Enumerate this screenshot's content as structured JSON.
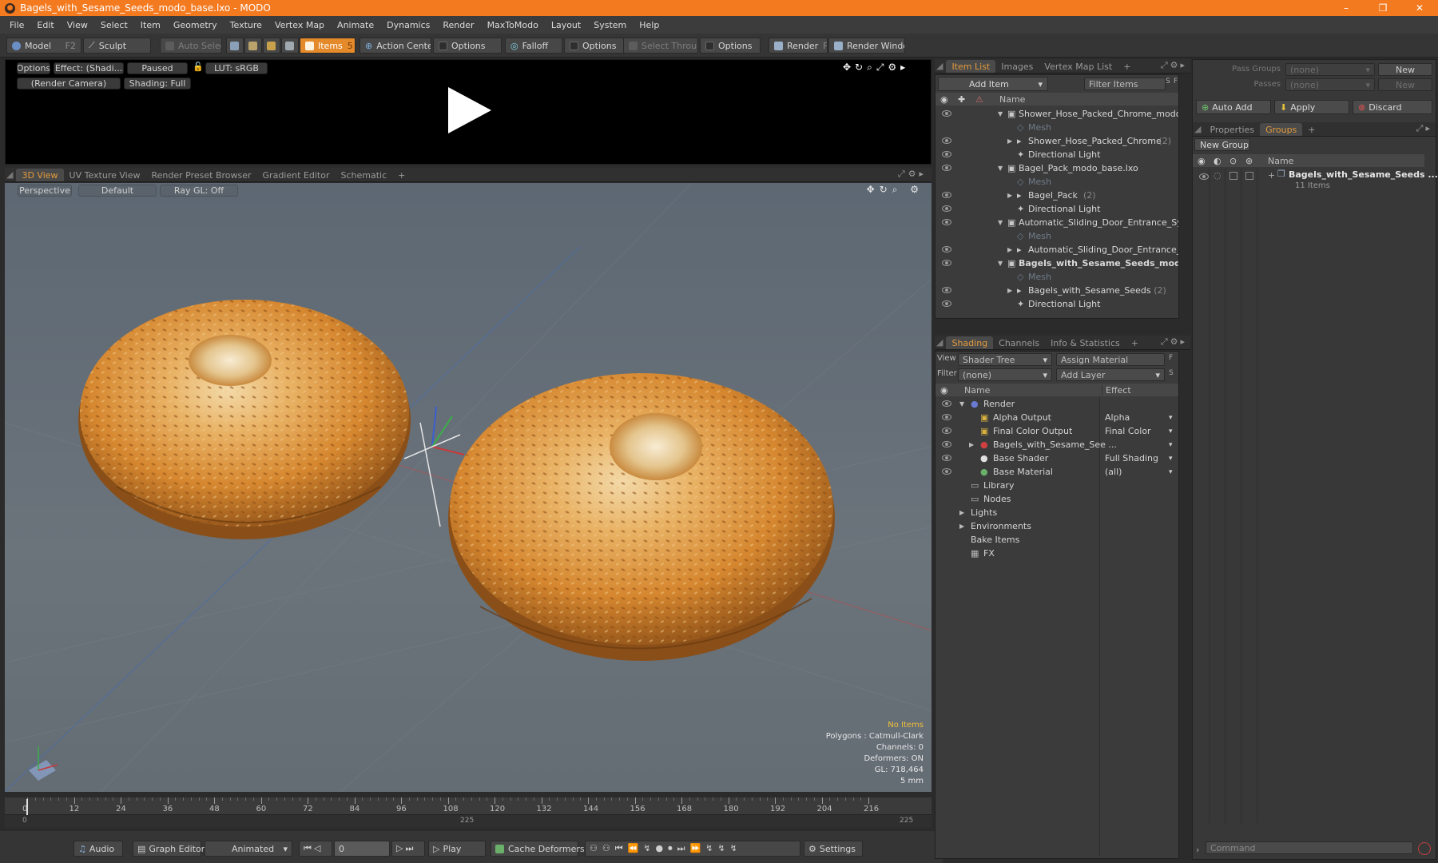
{
  "window": {
    "title": "Bagels_with_Sesame_Seeds_modo_base.lxo - MODO",
    "minimize": "–",
    "maximize": "❐",
    "close": "✕"
  },
  "menu": [
    "File",
    "Edit",
    "View",
    "Select",
    "Item",
    "Geometry",
    "Texture",
    "Vertex Map",
    "Animate",
    "Dynamics",
    "Render",
    "MaxToModo",
    "Layout",
    "System",
    "Help"
  ],
  "toolbar": {
    "model": "Model",
    "model_key": "F2",
    "sculpt": "Sculpt",
    "auto_select": "Auto Select",
    "items": "Items",
    "items_key": "5",
    "action_center": "Action Center",
    "options1": "Options",
    "falloff": "Falloff",
    "options2": "Options",
    "select_through": "Select Through",
    "options3": "Options",
    "render": "Render",
    "render_key": "F9",
    "render_window": "Render Window"
  },
  "preview": {
    "options": "Options",
    "effect": "Effect: (Shadi...",
    "paused": "Paused",
    "lut": "LUT: sRGB",
    "camera": "(Render Camera)",
    "shading": "Shading: Full"
  },
  "viewtabs": [
    "3D View",
    "UV Texture View",
    "Render Preset Browser",
    "Gradient Editor",
    "Schematic",
    "+"
  ],
  "viewport": {
    "perspective": "Perspective",
    "default": "Default",
    "raygl": "Ray GL: Off",
    "info": {
      "no_items": "No Items",
      "polygons": "Polygons : Catmull-Clark",
      "channels": "Channels: 0",
      "deformers": "Deformers: ON",
      "gl": "GL: 718,464",
      "scale": "5 mm"
    }
  },
  "timeline": {
    "ticks": [
      "0",
      "12",
      "24",
      "36",
      "48",
      "60",
      "72",
      "84",
      "96",
      "108",
      "120",
      "132",
      "144",
      "156",
      "168",
      "180",
      "192",
      "204",
      "216"
    ],
    "start": "0",
    "mid": "225",
    "end": "225"
  },
  "bottombar": {
    "audio": "Audio",
    "graph_editor": "Graph Editor",
    "animated": "Animated",
    "frame": "0",
    "play": "Play",
    "cache_deformers": "Cache Deformers",
    "settings": "Settings"
  },
  "itemlist": {
    "tabs": [
      "Item List",
      "Images",
      "Vertex Map List",
      "+"
    ],
    "add_item": "Add Item",
    "filter_items": "Filter Items",
    "s": "S",
    "f": "F",
    "name_col": "Name",
    "rows": [
      {
        "label": "Shower_Hose_Packed_Chrome_modo_b...",
        "indent": 0,
        "arrow": "▼",
        "bold": false,
        "dim": false,
        "count": ""
      },
      {
        "label": "Mesh",
        "indent": 1,
        "arrow": "",
        "bold": false,
        "dim": true,
        "count": ""
      },
      {
        "label": "Shower_Hose_Packed_Chrome",
        "indent": 1,
        "arrow": "▶",
        "bold": false,
        "dim": false,
        "count": "(2)"
      },
      {
        "label": "Directional Light",
        "indent": 1,
        "arrow": "",
        "bold": false,
        "dim": false,
        "count": ""
      },
      {
        "label": "Bagel_Pack_modo_base.lxo",
        "indent": 0,
        "arrow": "▼",
        "bold": false,
        "dim": false,
        "count": ""
      },
      {
        "label": "Mesh",
        "indent": 1,
        "arrow": "",
        "bold": false,
        "dim": true,
        "count": ""
      },
      {
        "label": "Bagel_Pack",
        "indent": 1,
        "arrow": "▶",
        "bold": false,
        "dim": false,
        "count": "(2)"
      },
      {
        "label": "Directional Light",
        "indent": 1,
        "arrow": "",
        "bold": false,
        "dim": false,
        "count": ""
      },
      {
        "label": "Automatic_Sliding_Door_Entrance_Syste...",
        "indent": 0,
        "arrow": "▼",
        "bold": false,
        "dim": false,
        "count": ""
      },
      {
        "label": "Mesh",
        "indent": 1,
        "arrow": "",
        "bold": false,
        "dim": true,
        "count": ""
      },
      {
        "label": "Automatic_Sliding_Door_Entrance_Sy...",
        "indent": 1,
        "arrow": "▶",
        "bold": false,
        "dim": false,
        "count": ""
      },
      {
        "label": "Bagels_with_Sesame_Seeds_mod...",
        "indent": 0,
        "arrow": "▼",
        "bold": true,
        "dim": false,
        "count": ""
      },
      {
        "label": "Mesh",
        "indent": 1,
        "arrow": "",
        "bold": false,
        "dim": true,
        "count": ""
      },
      {
        "label": "Bagels_with_Sesame_Seeds",
        "indent": 1,
        "arrow": "▶",
        "bold": false,
        "dim": false,
        "count": "(2)"
      },
      {
        "label": "Directional Light",
        "indent": 1,
        "arrow": "",
        "bold": false,
        "dim": false,
        "count": ""
      }
    ]
  },
  "shading": {
    "tabs": [
      "Shading",
      "Channels",
      "Info & Statistics",
      "+"
    ],
    "view_label": "View",
    "view_value": "Shader Tree",
    "assign_material": "Assign Material",
    "f": "F",
    "filter_label": "Filter",
    "filter_value": "(none)",
    "add_layer": "Add Layer",
    "s": "S",
    "name_col": "Name",
    "effect_col": "Effect",
    "rows": [
      {
        "label": "Render",
        "indent": 0,
        "arrow": "▼",
        "effect": "",
        "icon": "render-sphere-icon",
        "eye": true
      },
      {
        "label": "Alpha Output",
        "indent": 1,
        "arrow": "",
        "effect": "Alpha",
        "icon": "output-icon",
        "eye": true
      },
      {
        "label": "Final Color Output",
        "indent": 1,
        "arrow": "",
        "effect": "Final Color",
        "icon": "output-icon",
        "eye": true
      },
      {
        "label": "Bagels_with_Sesame_See ...",
        "indent": 1,
        "arrow": "▶",
        "effect": "",
        "icon": "material-group-icon",
        "eye": true
      },
      {
        "label": "Base Shader",
        "indent": 1,
        "arrow": "",
        "effect": "Full Shading",
        "icon": "shader-icon",
        "eye": true
      },
      {
        "label": "Base Material",
        "indent": 1,
        "arrow": "",
        "effect": "(all)",
        "icon": "material-icon",
        "eye": true
      },
      {
        "label": "Library",
        "indent": 0,
        "arrow": "",
        "effect": "",
        "icon": "folder-icon",
        "eye": false
      },
      {
        "label": "Nodes",
        "indent": 0,
        "arrow": "",
        "effect": "",
        "icon": "folder-icon",
        "eye": false
      },
      {
        "label": "Lights",
        "indent": 0,
        "arrow": "▶",
        "effect": "",
        "icon": "",
        "eye": false
      },
      {
        "label": "Environments",
        "indent": 0,
        "arrow": "▶",
        "effect": "",
        "icon": "",
        "eye": false
      },
      {
        "label": "Bake Items",
        "indent": 0,
        "arrow": "",
        "effect": "",
        "icon": "",
        "eye": false
      },
      {
        "label": "FX",
        "indent": 0,
        "arrow": "",
        "effect": "",
        "icon": "fx-icon",
        "eye": false
      }
    ]
  },
  "groups": {
    "pass_groups_label": "Pass Groups",
    "pass_groups_value": "(none)",
    "new1": "New",
    "passes_label": "Passes",
    "passes_value": "(none)",
    "new2": "New",
    "auto_add": "Auto Add",
    "apply": "Apply",
    "discard": "Discard",
    "tabs": [
      "Properties",
      "Groups",
      "+"
    ],
    "new_group": "New Group",
    "name_col": "Name",
    "group_name": "Bagels_with_Sesame_Seeds ...",
    "group_count": "11 Items"
  },
  "command": {
    "placeholder": "Command"
  },
  "colors": {
    "accent": "#f47a20",
    "tab_active": "#e39a3d",
    "bagel": "#c9792a"
  }
}
